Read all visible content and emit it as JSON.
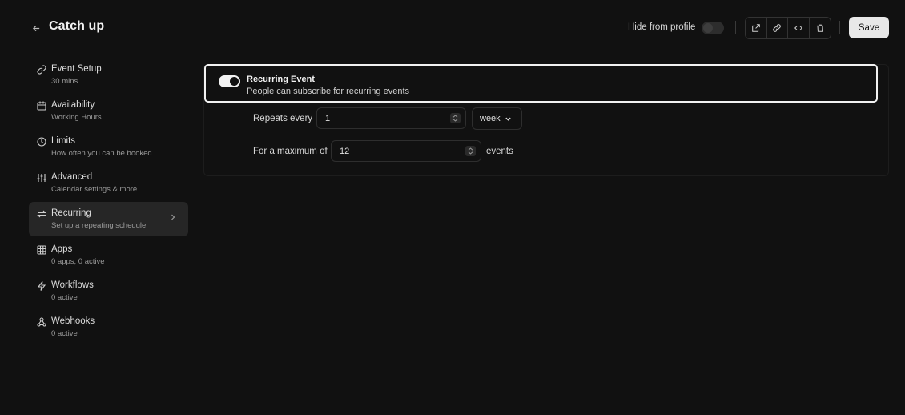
{
  "header": {
    "back_icon": "arrow-left-icon",
    "title": "Catch up",
    "hide_from_profile_label": "Hide from profile",
    "actions": [
      "external-link-icon",
      "link-icon",
      "code-icon",
      "trash-icon"
    ],
    "save_label": "Save"
  },
  "sidebar": {
    "items": [
      {
        "label": "Event Setup",
        "sub": "30 mins",
        "icon": "link-icon"
      },
      {
        "label": "Availability",
        "sub": "Working Hours",
        "icon": "calendar-icon"
      },
      {
        "label": "Limits",
        "sub": "How often you can be booked",
        "icon": "clock-icon"
      },
      {
        "label": "Advanced",
        "sub": "Calendar settings & more...",
        "icon": "sliders-icon"
      },
      {
        "label": "Recurring",
        "sub": "Set up a repeating schedule",
        "icon": "repeat-icon",
        "active": true
      },
      {
        "label": "Apps",
        "sub": "0 apps, 0 active",
        "icon": "grid-icon"
      },
      {
        "label": "Workflows",
        "sub": "0 active",
        "icon": "zap-icon"
      },
      {
        "label": "Webhooks",
        "sub": "0 active",
        "icon": "webhook-icon"
      }
    ]
  },
  "recurring": {
    "title": "Recurring Event",
    "description": "People can subscribe for recurring events",
    "enabled": true,
    "repeats_label": "Repeats every",
    "repeats_value": "1",
    "frequency": "week",
    "max_label": "For a maximum of",
    "max_value": "12",
    "events_label": "events"
  },
  "colors": {
    "background": "#111111",
    "active_item": "#262626",
    "accent": "#f2f2f2"
  }
}
